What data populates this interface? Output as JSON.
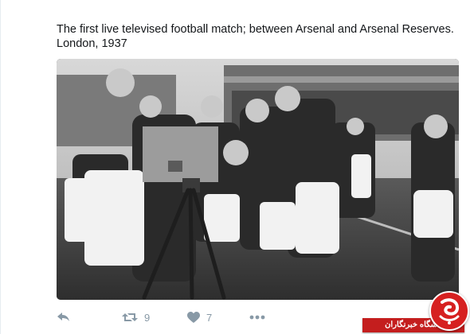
{
  "tweet": {
    "text_line1": "The first live televised football match; between Arsenal and Arsenal Reserves.",
    "text_line2": "London, 1937"
  },
  "photo": {
    "kind": "black-and-white historical photograph"
  },
  "actions": {
    "reply_icon": "reply-icon",
    "retweet_icon": "retweet-icon",
    "retweet_count": "9",
    "like_icon": "heart-icon",
    "like_count": "7",
    "more_icon": "more-icon"
  },
  "watermark": {
    "text": "باشگاه خبرنگاران",
    "logo": "site-logo"
  },
  "colors": {
    "text": "#14171a",
    "action_gray": "#8899a6",
    "watermark_red": "#c41e1e"
  }
}
